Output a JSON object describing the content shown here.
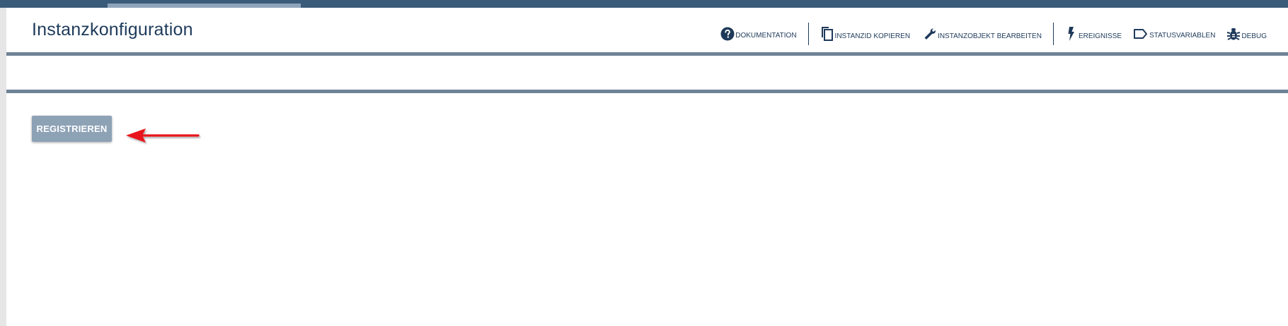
{
  "header": {
    "title": "Instanzkonfiguration"
  },
  "toolbar": {
    "documentation": {
      "label": "Dokumentation",
      "icon": "help-circle-icon"
    },
    "copy_id": {
      "label": "InstanzID kopieren",
      "icon": "copy-icon"
    },
    "edit_object": {
      "label": "Instanzobjekt bearbeiten",
      "icon": "wrench-icon"
    },
    "events": {
      "label": "Ereignisse",
      "icon": "lightning-icon"
    },
    "status_variables": {
      "label": "Statusvariablen",
      "icon": "tag-icon"
    },
    "debug": {
      "label": "Debug",
      "icon": "bug-icon"
    }
  },
  "actions": {
    "register_label": "REGISTRIEREN"
  },
  "colors": {
    "topbar": "#3b5b7a",
    "accent_text": "#1e3a5a",
    "button_bg": "#8ea2b6",
    "rule": "#6f8396",
    "annotation_arrow": "#e8191b"
  }
}
